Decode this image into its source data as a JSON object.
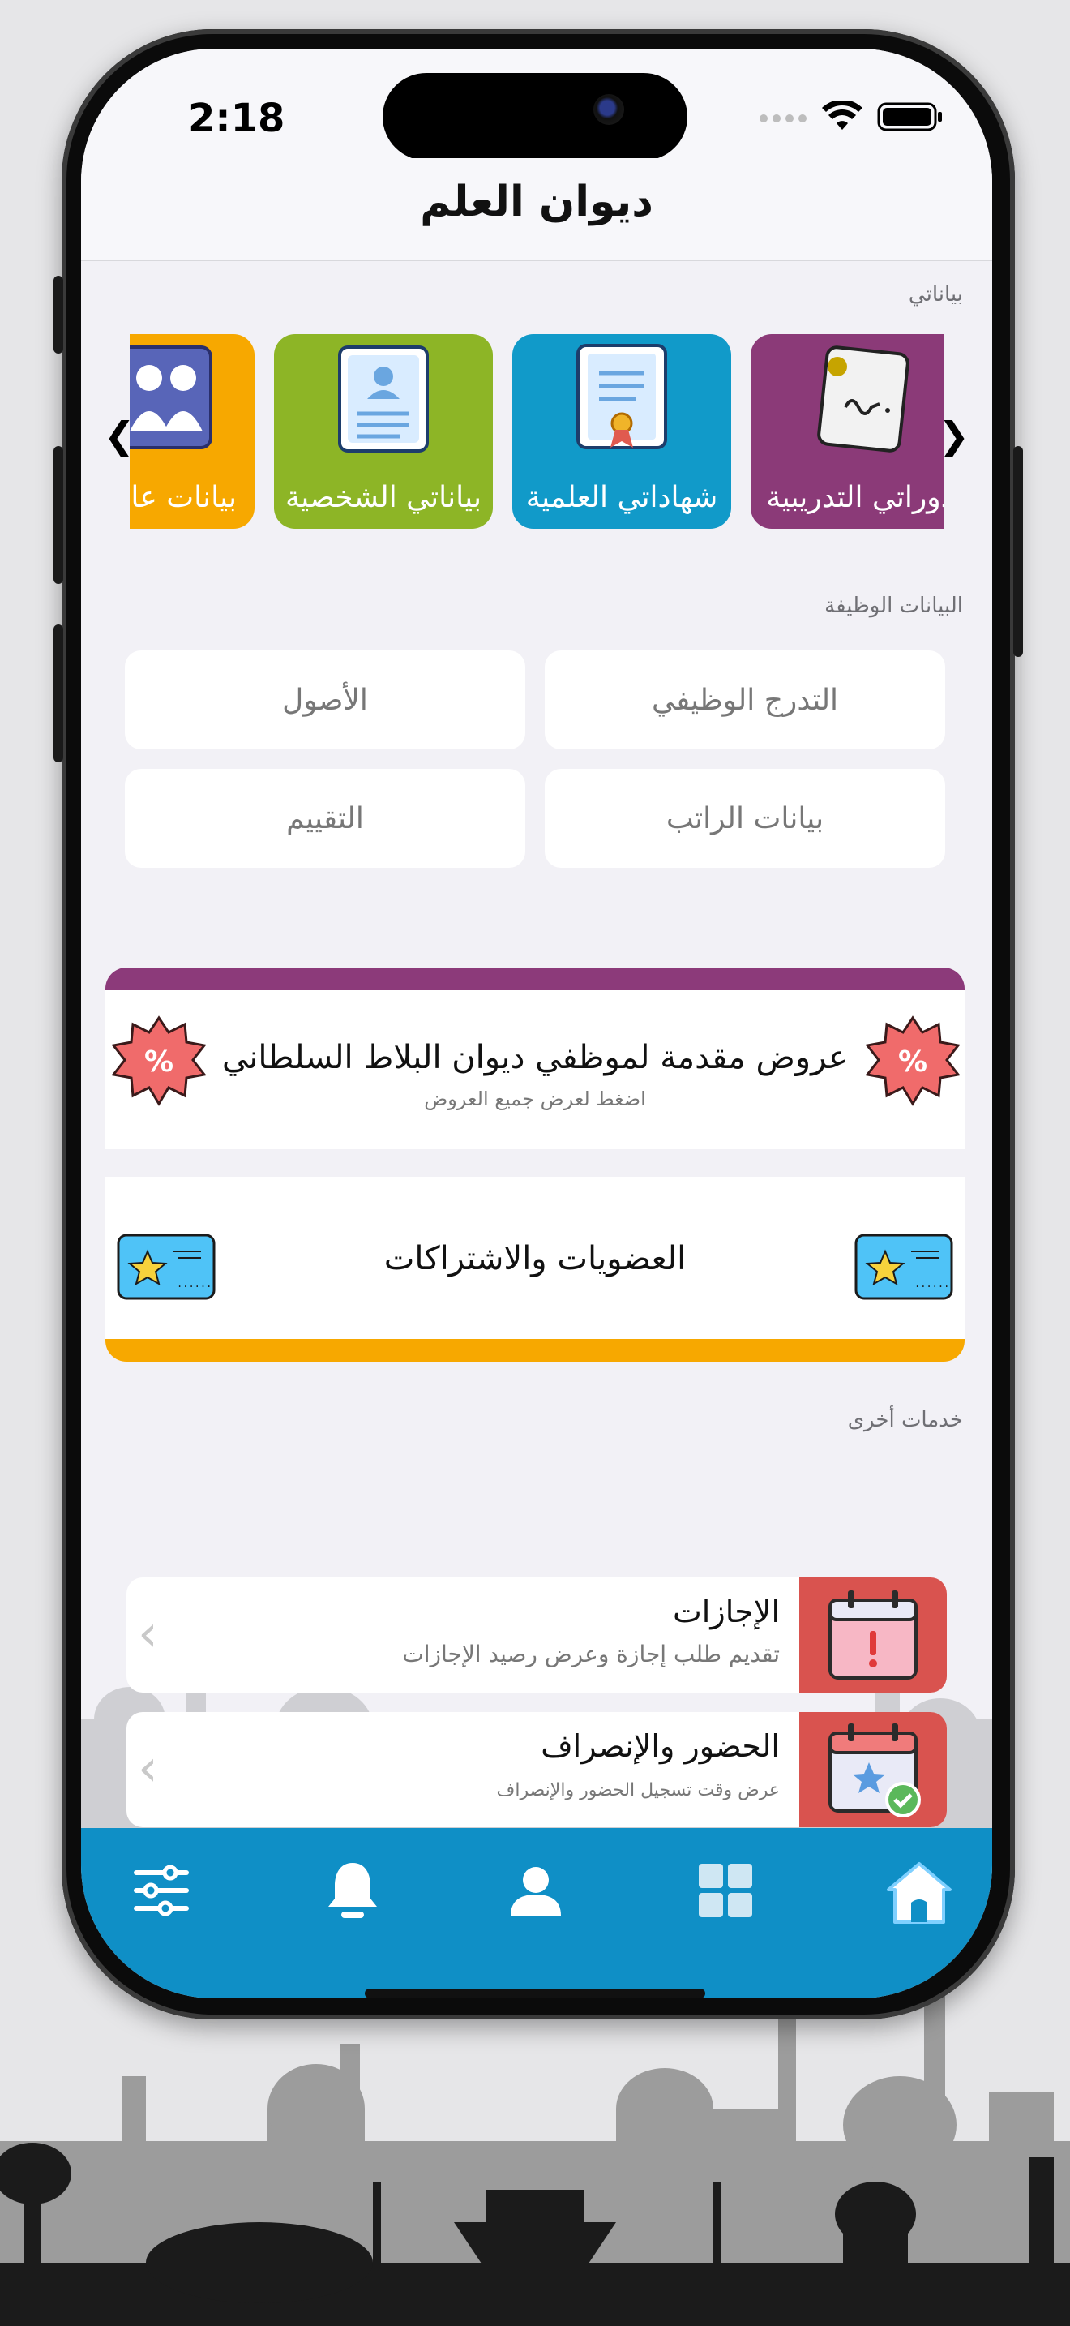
{
  "status_bar": {
    "time": "2:18"
  },
  "header": {
    "title": "ديوان العلم"
  },
  "my_data": {
    "section_label": "بياناتي",
    "cards": [
      {
        "label": "دوراتي التدريبية",
        "color": "#8b3a78",
        "icon": "note-icon"
      },
      {
        "label": "شهاداتي العلمية",
        "color": "#119ac9",
        "icon": "certificate-icon"
      },
      {
        "label": "بياناتي الشخصية",
        "color": "#8db526",
        "icon": "id-card-icon"
      },
      {
        "label": "بيانات عائلتي",
        "color": "#f7a800",
        "icon": "family-icon"
      }
    ]
  },
  "job_data": {
    "section_label": "البيانات الوظيفة",
    "buttons": [
      "التدرج الوظيفي",
      "الأصول",
      "بيانات الراتب",
      "التقييم"
    ]
  },
  "offers": {
    "title": "عروض مقدمة لموظفي ديوان البلاط السلطاني",
    "subtitle": "اضغط لعرض جميع العروض",
    "accent": "#8c3a7a"
  },
  "memberships": {
    "title": "العضويات والاشتراكات",
    "accent": "#f7a800"
  },
  "other_services": {
    "section_label": "خدمات أخرى",
    "items": [
      {
        "title": "الإجازات",
        "subtitle": "تقديم طلب إجازة وعرض رصيد الإجازات",
        "icon": "calendar-alert-icon"
      },
      {
        "title": "الحضور والإنصراف",
        "subtitle": "عرض وقت تسجيل الحضور والإنصراف",
        "icon": "calendar-check-icon"
      }
    ]
  },
  "tab_bar": {
    "color": "#0f8fc6",
    "tabs": [
      "home-icon",
      "grid-icon",
      "profile-icon",
      "bell-icon",
      "settings-sliders-icon"
    ]
  }
}
